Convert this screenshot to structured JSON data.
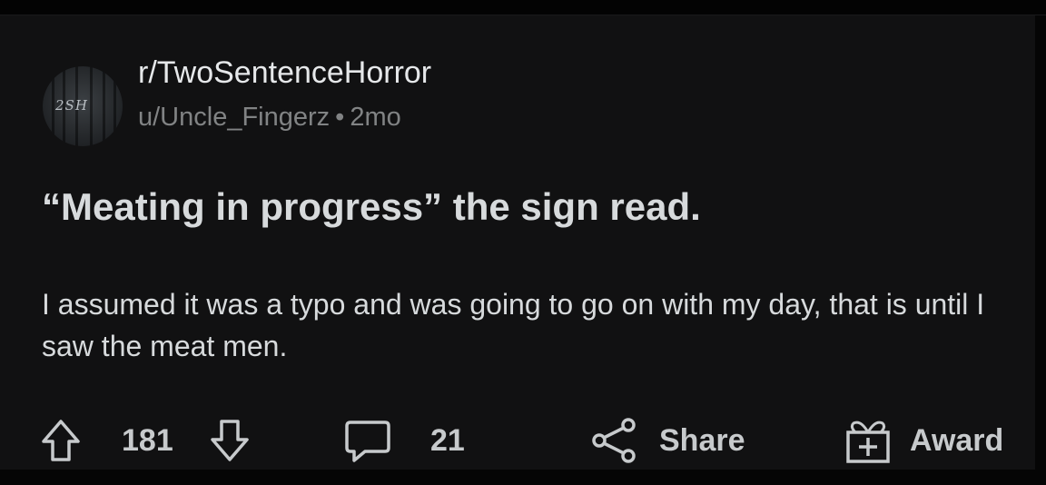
{
  "post": {
    "subreddit": "r/TwoSentenceHorror",
    "author": "u/Uncle_Fingerz",
    "separator": "•",
    "age": "2mo",
    "avatar_text": "2SH",
    "title": "“Meating in progress” the sign read.",
    "body": "I assumed it was a typo and was going to go on with my day, that is until I saw the meat men."
  },
  "actions": {
    "upvote_icon": "arrow-up-icon",
    "score": "181",
    "downvote_icon": "arrow-down-icon",
    "comment_icon": "speech-bubble-icon",
    "comments": "21",
    "share_icon": "share-icon",
    "share_label": "Share",
    "award_icon": "gift-box-icon",
    "award_label": "Award"
  },
  "colors": {
    "background": "#111112",
    "text": "#d7dadc",
    "meta": "#818384"
  }
}
